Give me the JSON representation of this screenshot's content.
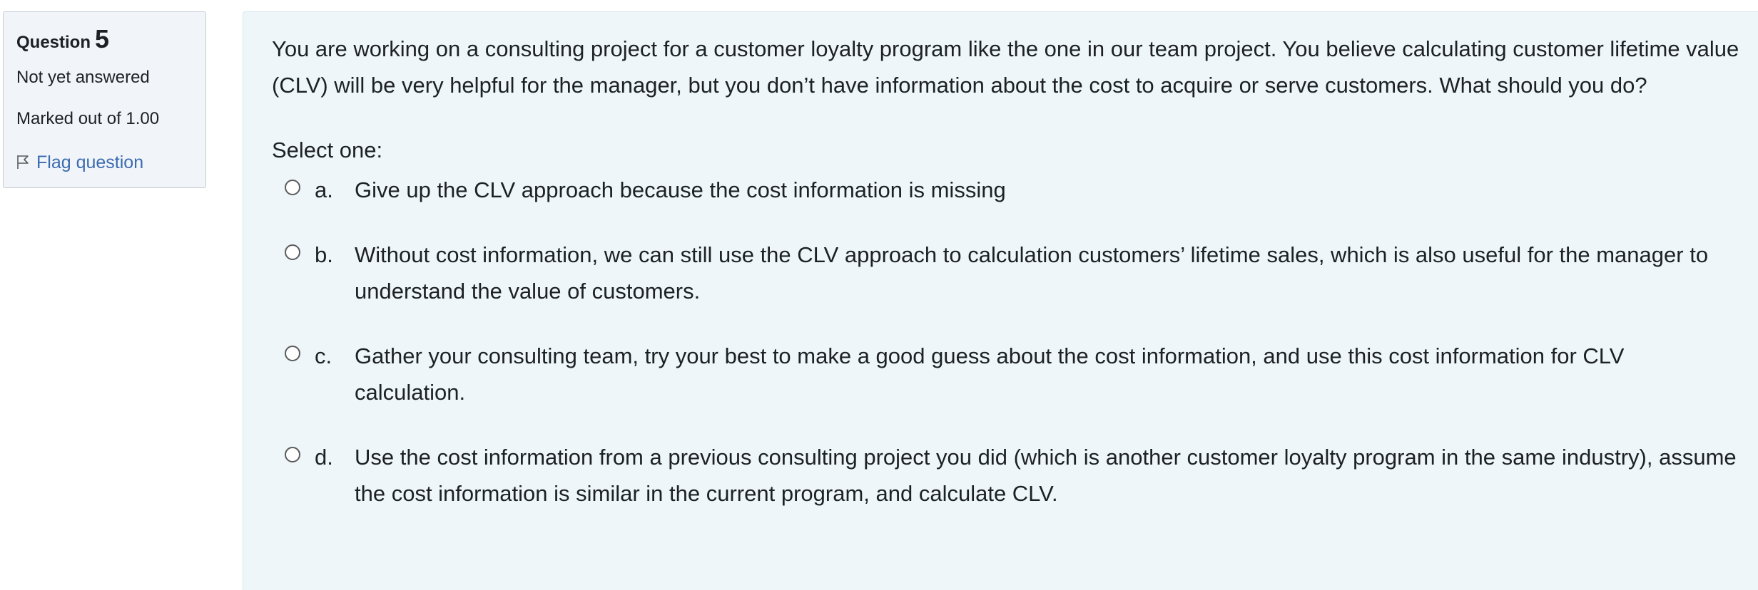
{
  "question_info": {
    "label": "Question",
    "number": "5",
    "state": "Not yet answered",
    "grade": "Marked out of 1.00",
    "flag_label": "Flag question"
  },
  "question": {
    "text": "You are working on a consulting project for a customer loyalty program like the one in our team project. You believe calculating customer lifetime value (CLV) will be very helpful for the manager, but you don’t have information about the cost to acquire or serve customers. What should you do?",
    "prompt": "Select one:",
    "answers": [
      {
        "letter": "a.",
        "text": "Give up the CLV approach because the cost information is missing"
      },
      {
        "letter": "b.",
        "text": "Without cost information, we can still use the CLV approach to calculation customers’ lifetime sales, which is also useful for the manager to understand the value of customers."
      },
      {
        "letter": "c.",
        "text": "Gather your consulting team, try your best to make a good guess about the cost information, and use this cost information for CLV calculation."
      },
      {
        "letter": "d.",
        "text": "Use the cost information from a previous consulting project you did (which is another customer loyalty program in the same industry), assume the cost information is similar in the current program, and calculate CLV."
      }
    ]
  },
  "colors": {
    "info_bg": "#f1f5f9",
    "content_bg": "#eef6fa",
    "link": "#3b6bb0"
  },
  "icons": {
    "flag": "flag-icon",
    "radio": "radio-button"
  }
}
